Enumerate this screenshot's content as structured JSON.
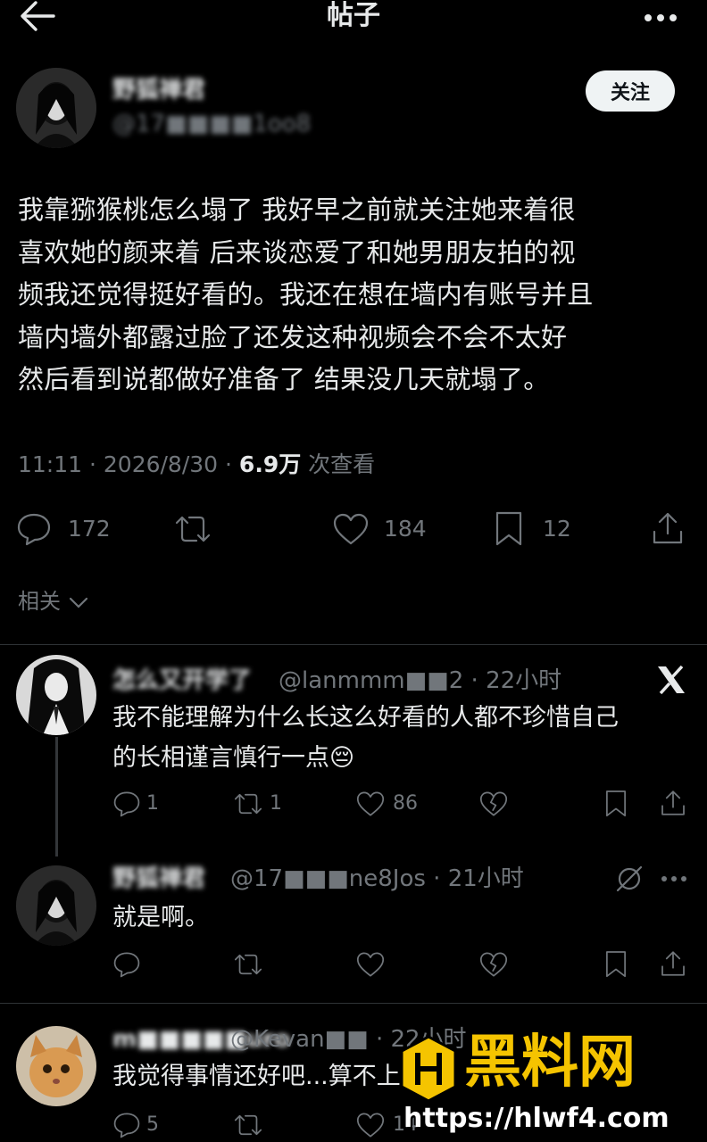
{
  "header": {
    "title": "帖子"
  },
  "post": {
    "author_name": "野狐禅君",
    "author_handle": "@17■■■■1oo8",
    "follow_label": "关注",
    "text_lines": [
      "我靠猕猴桃怎么塌了 我好早之前就关注她来着很",
      "喜欢她的颜来着 后来谈恋爱了和她男朋友拍的视",
      "频我还觉得挺好看的。我还在想在墙内有账号并且",
      "墙内墙外都露过脸了还发这种视频会不会不太好",
      "然后看到说都做好准备了 结果没几天就塌了。"
    ],
    "time": "11:11 · 2026/8/30 · ",
    "views": "6.9万",
    "views_label": " 次查看",
    "stats": {
      "replies": "172",
      "likes": "184",
      "bookmarks": "12"
    },
    "related_label": "相关"
  },
  "replies": [
    {
      "name": "怎么又开学了",
      "handle": "@lanmmm■■2 · 22小时",
      "text_lines": [
        "我不能理解为什么长这么好看的人都不珍惜自己",
        "的长相谨言慎行一点😔"
      ],
      "stats": {
        "replies": "1",
        "reposts": "1",
        "likes": "86"
      }
    },
    {
      "name": "野狐禅君",
      "handle": "@17■■■ne8Jos · 21小时",
      "text_lines": [
        "就是啊。"
      ],
      "stats": {
        "replies": "",
        "reposts": "",
        "likes": ""
      }
    },
    {
      "name": "m■■■■■uro",
      "handle": "@Kevan■■ · 22小时",
      "text_lines": [
        "我觉得事情还好吧...算不上塌"
      ],
      "stats": {
        "replies": "5",
        "reposts": "",
        "likes": "14"
      }
    }
  ],
  "watermark": {
    "title": "黑料网",
    "url": "https://hlwf4.com"
  },
  "colors": {
    "background": "#000000",
    "text": "#e7e9ea",
    "muted": "#71767b",
    "watermark_yellow": "#f5c400"
  }
}
